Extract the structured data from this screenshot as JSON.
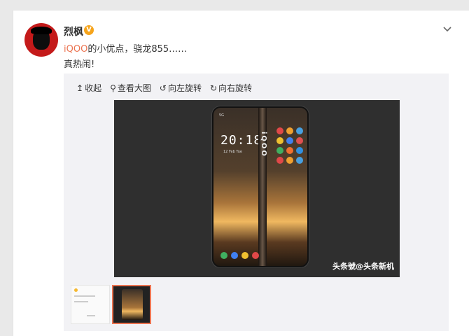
{
  "post": {
    "username": "烈枫",
    "verified_badge": "V",
    "text_tag": "iQOO",
    "text_rest": "的小优点，骁龙855……",
    "text_line2": "真热闹!"
  },
  "toolbar": {
    "collapse_icon": "↥",
    "collapse_label": "收起",
    "view_large_icon": "⚲",
    "view_large_label": "查看大图",
    "rotate_left_icon": "↺",
    "rotate_left_label": "向左旋转",
    "rotate_right_icon": "↻",
    "rotate_right_label": "向右旋转"
  },
  "photo": {
    "clock": "20:18",
    "date": "12 Feb Tue",
    "brand": "iQOO",
    "status": "5G",
    "watermark": "头条號@头条新机"
  },
  "colors": {
    "accent": "#eb7350",
    "badge": "#f6a41b"
  }
}
